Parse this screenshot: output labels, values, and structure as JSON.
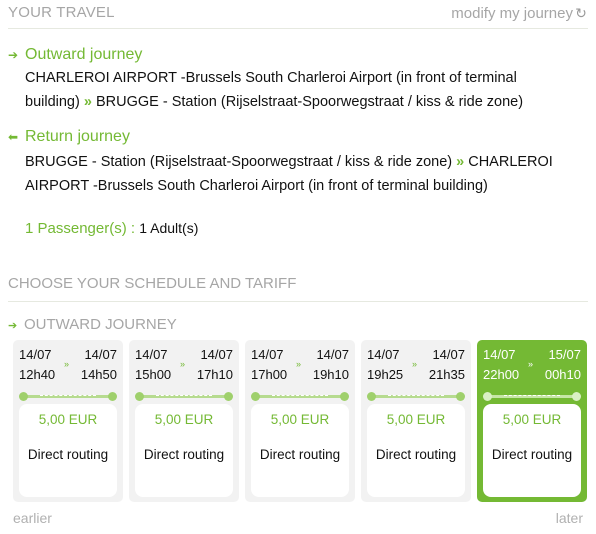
{
  "header": {
    "title": "YOUR TRAVEL",
    "modify_label": "modify my journey",
    "modify_icon": "refresh-icon"
  },
  "outward": {
    "title": "Outward journey",
    "line1": "CHARLEROI AIRPORT -Brussels South Charleroi Airport (in front of terminal",
    "line2a": "building)",
    "sep": "»",
    "line2b": "BRUGGE - Station (Rijselstraat-Spoorwegstraat / kiss & ride zone)"
  },
  "return": {
    "title": "Return journey",
    "line1a": "BRUGGE - Station (Rijselstraat-Spoorwegstraat / kiss & ride zone)",
    "sep": "»",
    "line1b": "CHARLEROI",
    "line2": "AIRPORT -Brussels South Charleroi Airport (in front of terminal building)"
  },
  "passengers": {
    "label": "1 Passenger(s) :",
    "value": "1 Adult(s)"
  },
  "schedule": {
    "title": "CHOOSE YOUR SCHEDULE AND TARIFF",
    "outward_title": "OUTWARD JOURNEY",
    "chevron": "»",
    "cards": [
      {
        "dep_date": "14/07",
        "dep_time": "12h40",
        "arr_date": "14/07",
        "arr_time": "14h50",
        "price": "5,00 EUR",
        "routing": "Direct routing"
      },
      {
        "dep_date": "14/07",
        "dep_time": "15h00",
        "arr_date": "14/07",
        "arr_time": "17h10",
        "price": "5,00 EUR",
        "routing": "Direct routing"
      },
      {
        "dep_date": "14/07",
        "dep_time": "17h00",
        "arr_date": "14/07",
        "arr_time": "19h10",
        "price": "5,00 EUR",
        "routing": "Direct routing"
      },
      {
        "dep_date": "14/07",
        "dep_time": "19h25",
        "arr_date": "14/07",
        "arr_time": "21h35",
        "price": "5,00 EUR",
        "routing": "Direct routing"
      },
      {
        "dep_date": "14/07",
        "dep_time": "22h00",
        "arr_date": "15/07",
        "arr_time": "00h10",
        "price": "5,00 EUR",
        "routing": "Direct routing"
      }
    ],
    "selected_index": 4,
    "earlier_label": "earlier",
    "later_label": "later"
  },
  "colors": {
    "accent": "#74b934",
    "muted": "#a6a6a6",
    "card_bg": "#f2f2f2"
  }
}
